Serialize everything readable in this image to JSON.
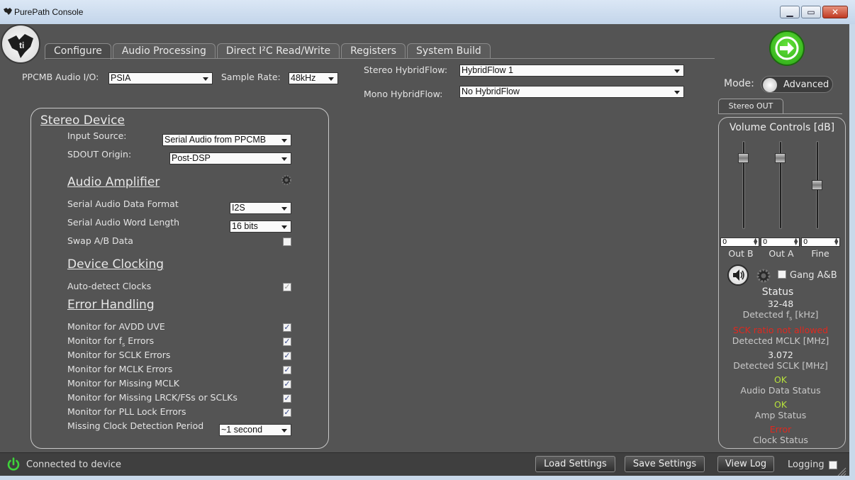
{
  "window": {
    "title": "PurePath Console"
  },
  "tabs": [
    "Configure",
    "Audio Processing",
    "Direct I²C Read/Write",
    "Registers",
    "System Build"
  ],
  "audio_io": {
    "label": "PPCMB Audio I/O:",
    "value": "PSIA"
  },
  "sample_rate": {
    "label": "Sample Rate:",
    "value": "48kHz"
  },
  "stereo_hybridflow": {
    "label": "Stereo HybridFlow:",
    "value": "HybridFlow 1"
  },
  "mono_hybridflow": {
    "label": "Mono HybridFlow:",
    "value": "No HybridFlow"
  },
  "mode": {
    "label": "Mode:",
    "value": "Advanced"
  },
  "stereo_device": {
    "title": "Stereo Device",
    "input_source_label": "Input Source:",
    "input_source_value": "Serial Audio from PPCMB",
    "sdout_label": "SDOUT Origin:",
    "sdout_value": "Post-DSP"
  },
  "audio_amplifier": {
    "title": "Audio Amplifier",
    "format_label": "Serial Audio Data Format",
    "format_value": "I2S",
    "word_label": "Serial Audio Word Length",
    "word_value": "16 bits",
    "swap_label": "Swap A/B Data",
    "swap_checked": false
  },
  "device_clocking": {
    "title": "Device Clocking",
    "autodetect_label": "Auto-detect Clocks",
    "autodetect_checked": true
  },
  "error_handling": {
    "title": "Error Handling",
    "items": [
      {
        "label": "Monitor for AVDD UVE",
        "checked": true
      },
      {
        "label": "Monitor for SCLK Errors",
        "checked": true
      },
      {
        "label": "Monitor for MCLK Errors",
        "checked": true
      },
      {
        "label": "Monitor for Missing MCLK",
        "checked": true
      },
      {
        "label": "Monitor for Missing LRCK/FSs or SCLKs",
        "checked": true
      },
      {
        "label": "Monitor for PLL Lock Errors",
        "checked": true
      }
    ],
    "fs_label_pre": "Monitor for f",
    "fs_label_sub": "s",
    "fs_label_post": " Errors",
    "fs_checked": true,
    "period_label": "Missing Clock Detection Period",
    "period_value": "~1 second"
  },
  "right_panel": {
    "tab": "Stereo OUT",
    "title": "Volume Controls [dB]",
    "sliders": [
      {
        "label": "Out B",
        "value": "0",
        "level": 0.85
      },
      {
        "label": "Out A",
        "value": "0",
        "level": 0.85
      },
      {
        "label": "Fine",
        "value": "0",
        "level": 0.5
      }
    ],
    "gang_label": "Gang A&B",
    "gang_checked": false,
    "status_title": "Status",
    "detected_fs_value": "32-48",
    "detected_fs_label_pre": "Detected f",
    "detected_fs_label_sub": "s",
    "detected_fs_label_post": " [kHz]",
    "mclk_value": "SCK ratio not allowed",
    "mclk_label": "Detected MCLK [MHz]",
    "sclk_value": "3.072",
    "sclk_label": "Detected SCLK [MHz]",
    "audio_data_value": "OK",
    "audio_data_label": "Audio Data Status",
    "amp_value": "OK",
    "amp_label": "Amp Status",
    "clock_value": "Error",
    "clock_label": "Clock Status",
    "colors": {
      "ok": "#b7e23b",
      "error": "#e0281e"
    }
  },
  "statusbar": {
    "connection": "Connected to device",
    "load": "Load Settings",
    "save": "Save Settings",
    "view_log": "View Log",
    "logging": "Logging"
  }
}
